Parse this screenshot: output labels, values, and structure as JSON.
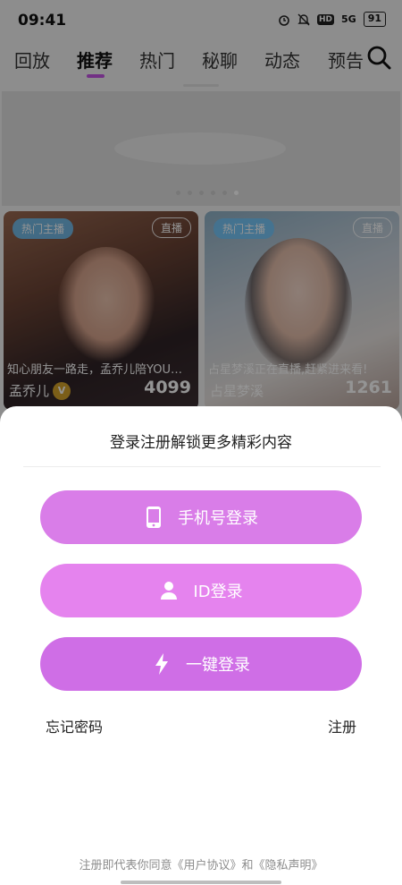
{
  "status_bar": {
    "time": "09:41",
    "signal": "5G",
    "hd": "HD",
    "battery": "91"
  },
  "tabs": [
    {
      "label": "回放"
    },
    {
      "label": "推荐"
    },
    {
      "label": "热门"
    },
    {
      "label": "秘聊"
    },
    {
      "label": "动态"
    },
    {
      "label": "预告"
    }
  ],
  "active_tab": "推荐",
  "banner": {
    "dot_count": 6,
    "active_dot": 6
  },
  "cards": [
    {
      "badge": "热门主播",
      "live_label": "直播",
      "caption": "知心朋友一路走，孟乔儿陪YOU…",
      "name": "孟乔儿",
      "vip_label": "V",
      "count": "4099"
    },
    {
      "badge": "热门主播",
      "live_label": "直播",
      "caption": "占星梦溪正在直播,赶紧进来看!",
      "name": "占星梦溪",
      "count": "1261"
    }
  ],
  "login_sheet": {
    "title": "登录注册解锁更多精彩内容",
    "phone_login": "手机号登录",
    "id_login": "ID登录",
    "quick_login": "一键登录",
    "forgot_password": "忘记密码",
    "register": "注册",
    "agreement": "注册即代表你同意《用户协议》和《隐私声明》"
  },
  "icons": {
    "phone": "phone-icon",
    "user": "user-icon",
    "lightning": "lightning-icon",
    "search": "search-icon",
    "alarm": "alarm-icon",
    "mute": "mute-icon"
  },
  "colors": {
    "accent": "#d97de8",
    "overlay": "rgba(0,0,0,0.42)"
  }
}
